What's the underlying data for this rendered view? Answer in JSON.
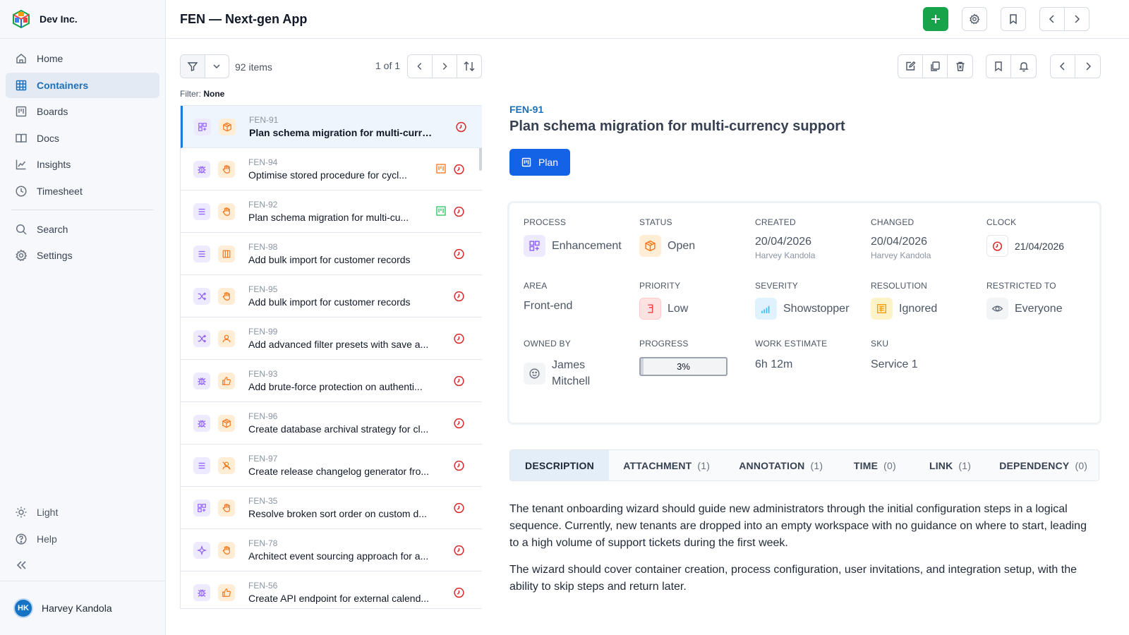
{
  "sidebar": {
    "company": "Dev Inc.",
    "items": [
      {
        "label": "Home",
        "icon": "home-icon"
      },
      {
        "label": "Containers",
        "icon": "grid-icon",
        "active": true
      },
      {
        "label": "Boards",
        "icon": "board-icon"
      },
      {
        "label": "Docs",
        "icon": "docs-icon"
      },
      {
        "label": "Insights",
        "icon": "chart-icon"
      },
      {
        "label": "Timesheet",
        "icon": "clock-icon"
      }
    ],
    "secondary": [
      {
        "label": "Search",
        "icon": "search-icon"
      },
      {
        "label": "Settings",
        "icon": "gear-icon"
      }
    ],
    "bottom": [
      {
        "label": "Light",
        "icon": "sun-icon"
      },
      {
        "label": "Help",
        "icon": "help-icon"
      }
    ],
    "user": {
      "initials": "HK",
      "name": "Harvey Kandola"
    }
  },
  "header": {
    "title": "FEN — Next-gen App"
  },
  "list": {
    "count": "92 items",
    "pager": "1 of 1",
    "filter_label": "Filter:",
    "filter_value": "None",
    "rows": [
      {
        "id": "FEN-91",
        "title": "Plan schema migration for multi-curre...",
        "type": "grid-icon",
        "status": "box-icon",
        "flag": "",
        "selected": true
      },
      {
        "id": "FEN-94",
        "title": "Optimise stored procedure for cycl...",
        "type": "bug-icon",
        "status": "hand-icon",
        "flag": "orange"
      },
      {
        "id": "FEN-92",
        "title": "Plan schema migration for multi-cu...",
        "type": "list-icon",
        "status": "hand-icon",
        "flag": "green"
      },
      {
        "id": "FEN-98",
        "title": "Add bulk import for customer records",
        "type": "list-icon",
        "status": "columns-icon",
        "flag": ""
      },
      {
        "id": "FEN-95",
        "title": "Add bulk import for customer records",
        "type": "shuffle-icon",
        "status": "hand-icon",
        "flag": ""
      },
      {
        "id": "FEN-99",
        "title": "Add advanced filter presets with save a...",
        "type": "shuffle-icon",
        "status": "user-icon",
        "flag": ""
      },
      {
        "id": "FEN-93",
        "title": "Add brute-force protection on authenti...",
        "type": "bug-icon",
        "status": "thumbs-up-icon",
        "flag": ""
      },
      {
        "id": "FEN-96",
        "title": "Create database archival strategy for cl...",
        "type": "bug-icon",
        "status": "box-icon",
        "flag": ""
      },
      {
        "id": "FEN-97",
        "title": "Create release changelog generator fro...",
        "type": "list-icon",
        "status": "user-x-icon",
        "flag": ""
      },
      {
        "id": "FEN-35",
        "title": "Resolve broken sort order on custom d...",
        "type": "grid-icon",
        "status": "hand-icon",
        "flag": ""
      },
      {
        "id": "FEN-78",
        "title": "Architect event sourcing approach for a...",
        "type": "sparkle-icon",
        "status": "hand-icon",
        "flag": ""
      },
      {
        "id": "FEN-56",
        "title": "Create API endpoint for external calend...",
        "type": "bug-icon",
        "status": "thumbs-up-icon",
        "flag": ""
      }
    ]
  },
  "detail": {
    "id": "FEN-91",
    "title": "Plan schema migration for multi-currency support",
    "plan_label": "Plan",
    "props": {
      "process": {
        "label": "PROCESS",
        "value": "Enhancement"
      },
      "status": {
        "label": "STATUS",
        "value": "Open"
      },
      "created": {
        "label": "CREATED",
        "value": "20/04/2026",
        "by": "Harvey Kandola"
      },
      "changed": {
        "label": "CHANGED",
        "value": "20/04/2026",
        "by": "Harvey Kandola"
      },
      "clock": {
        "label": "CLOCK",
        "value": "21/04/2026"
      },
      "area": {
        "label": "AREA",
        "value": "Front-end"
      },
      "priority": {
        "label": "PRIORITY",
        "value": "Low"
      },
      "severity": {
        "label": "SEVERITY",
        "value": "Showstopper"
      },
      "resolution": {
        "label": "RESOLUTION",
        "value": "Ignored"
      },
      "restricted": {
        "label": "RESTRICTED TO",
        "value": "Everyone"
      },
      "owner": {
        "label": "OWNED BY",
        "first": "James",
        "last": "Mitchell"
      },
      "progress": {
        "label": "PROGRESS",
        "value": "3%",
        "fraction": 0.03
      },
      "estimate": {
        "label": "WORK ESTIMATE",
        "value": "6h 12m"
      },
      "sku": {
        "label": "SKU",
        "value": "Service 1"
      }
    },
    "tabs": [
      {
        "label": "DESCRIPTION",
        "count": ""
      },
      {
        "label": "ATTACHMENT",
        "count": "(1)"
      },
      {
        "label": "ANNOTATION",
        "count": "(1)"
      },
      {
        "label": "TIME",
        "count": "(0)"
      },
      {
        "label": "LINK",
        "count": "(1)"
      },
      {
        "label": "DEPENDENCY",
        "count": "(0)"
      }
    ],
    "description": [
      "The tenant onboarding wizard should guide new administrators through the initial configuration steps in a logical sequence. Currently, new tenants are dropped into an empty workspace with no guidance on where to start, leading to a high volume of support tickets during the first week.",
      "The wizard should cover container creation, process configuration, user invitations, and integration setup, with the ability to skip steps and return later."
    ]
  },
  "colors": {
    "accent": "#1d6fb8",
    "primary_button": "#1463e6",
    "add_button": "#16a34a",
    "clock_red": "#dc2626"
  }
}
